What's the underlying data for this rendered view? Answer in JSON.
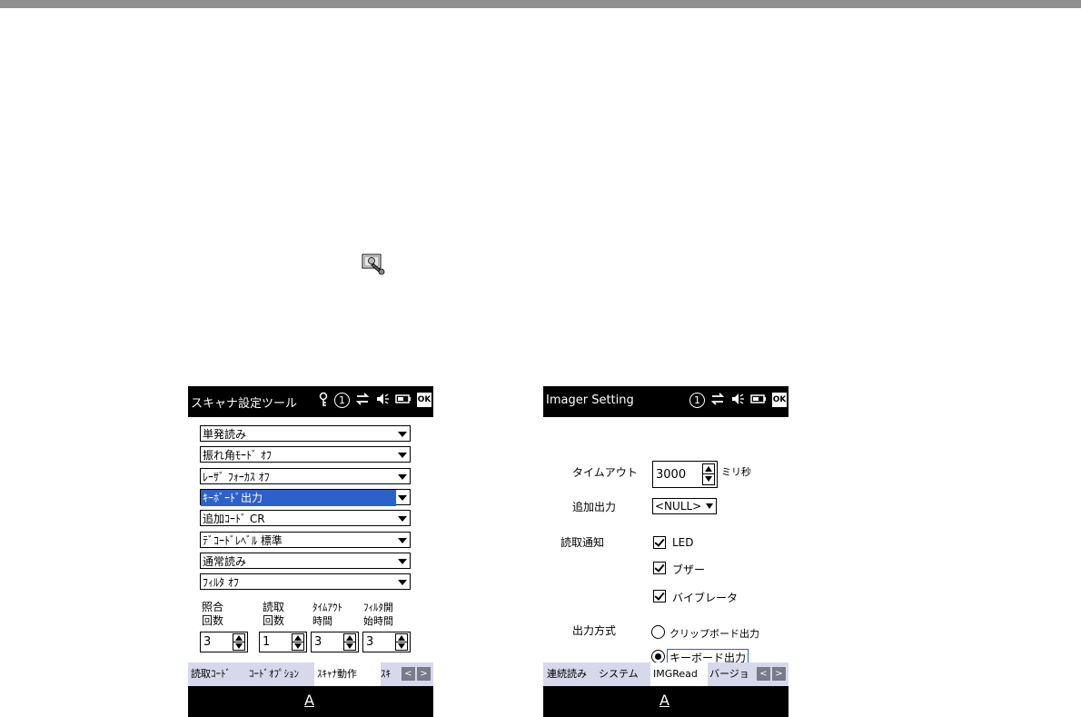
{
  "accent_color": "#2a62c9",
  "devices": {
    "scanner": {
      "title": "スキャナ設定ツール",
      "status_icons": [
        "key-icon",
        "circle-one-icon",
        "sync-arrows-icon",
        "speaker-icon",
        "battery-icon",
        "ok-icon"
      ],
      "ok_label": "OK",
      "circle_label": "1",
      "dropdowns": [
        "単発読み",
        "振れ角ﾓｰﾄﾞ ｵﾌ",
        "ﾚｰｻﾞ ﾌｫｰｶｽ ｵﾌ",
        "ｷｰﾎﾞｰﾄﾞ出力",
        "追加ｺｰﾄﾞ CR",
        "ﾃﾞｺｰﾄﾞﾚﾍﾞﾙ 標準",
        "通常読み",
        "ﾌｨﾙﾀ ｵﾌ"
      ],
      "selected_dropdown_index": 3,
      "spinner_labels": [
        [
          "照合",
          "回数"
        ],
        [
          "読取",
          "回数"
        ],
        [
          "ﾀｲﾑｱｳﾄ",
          "時間"
        ],
        [
          "ﾌｨﾙﾀ開",
          "始時間"
        ]
      ],
      "spinner_values": [
        "3",
        "1",
        "3",
        "3"
      ],
      "tabs": [
        "読取ｺｰﾄﾞ",
        "ｺｰﾄﾞｵﾌﾟｼｮﾝ",
        "ｽｷｬﾅ動作",
        "ｽｷ"
      ],
      "active_tab": "ｽｷｬﾅ動作",
      "keyboard_label": "A"
    },
    "imager": {
      "title": "Imager Setting",
      "ok_label": "OK",
      "circle_label": "1",
      "timeout_label": "タイムアウト",
      "timeout_value": "3000",
      "timeout_unit": "ミリ秒",
      "extra_output_label": "追加出力",
      "extra_output_value": "<NULL>",
      "notify_label": "読取通知",
      "notify_options": [
        "LED",
        "ブザー",
        "バイブレータ"
      ],
      "output_method_label": "出力方式",
      "output_options": [
        "クリップボード出力",
        "キーボード出力"
      ],
      "selected_output": "キーボード出力",
      "tabs": [
        "連続読み",
        "システム",
        "IMGRead",
        "バージョ"
      ],
      "active_tab": "IMGRead",
      "keyboard_label": "A"
    }
  }
}
